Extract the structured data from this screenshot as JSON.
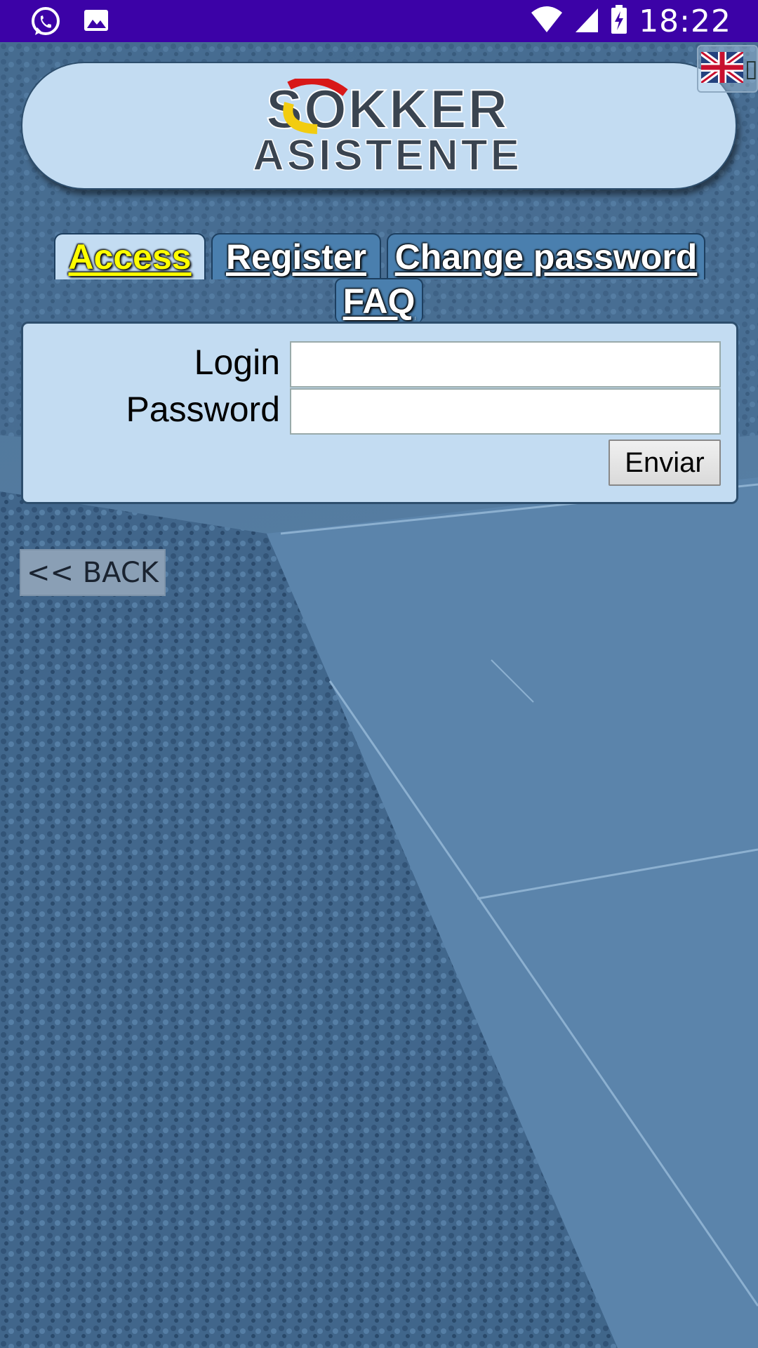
{
  "status_bar": {
    "time": "18:22",
    "left_icons": [
      "whatsapp-icon",
      "image-icon"
    ],
    "right_icons": [
      "wifi-icon",
      "signal-icon",
      "battery-charging-icon"
    ]
  },
  "header": {
    "logo_line1": "SOKKER",
    "logo_line2": "ASISTENTE",
    "language_flag": "uk-flag-icon"
  },
  "tabs": [
    {
      "label": "Access",
      "active": true
    },
    {
      "label": "Register",
      "active": false
    },
    {
      "label": "Change password",
      "active": false
    },
    {
      "label": "FAQ",
      "active": false
    }
  ],
  "login_form": {
    "login_label": "Login",
    "login_value": "",
    "password_label": "Password",
    "password_value": "",
    "submit_label": "Enviar"
  },
  "back_button": {
    "label": "<< BACK"
  },
  "colors": {
    "status_bar": "#3c02a7",
    "panel": "#c3dcf2",
    "active_tab_text": "#ffff00",
    "background": "#4a7197"
  }
}
